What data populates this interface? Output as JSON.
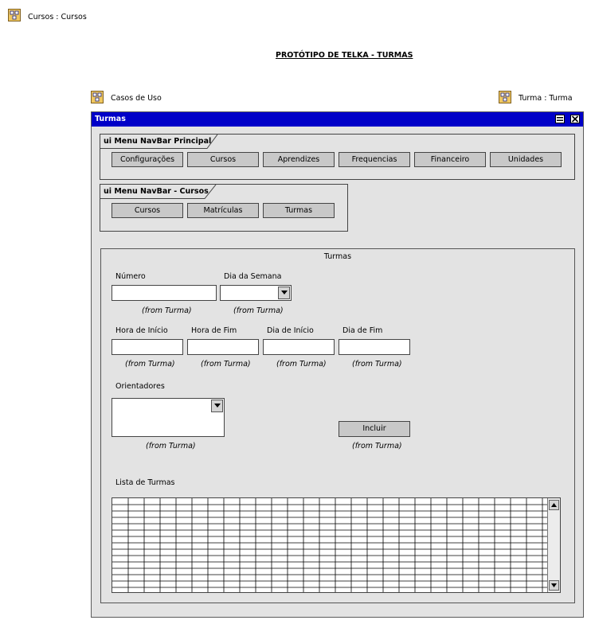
{
  "header": {
    "top_package_label": "Cursos : Cursos",
    "diagram_title": "PROTÓTIPO DE TELKA - TURMAS",
    "left_package_label": "Casos de Uso",
    "right_package_label": "Turma : Turma"
  },
  "window": {
    "title": "Turmas"
  },
  "navbar_principal": {
    "title": "ui Menu NavBar Principal",
    "items": [
      "Configurações",
      "Cursos",
      "Aprendizes",
      "Frequencias",
      "Financeiro",
      "Unidades"
    ]
  },
  "navbar_cursos": {
    "title": "ui Menu NavBar - Cursos",
    "items": [
      "Cursos",
      "Matrículas",
      "Turmas"
    ]
  },
  "form": {
    "title": "Turmas",
    "numero_label": "Número",
    "dia_semana_label": "Dia da Semana",
    "hora_inicio_label": "Hora de Início",
    "hora_fim_label": "Hora de Fim",
    "dia_inicio_label": "Dia de Início",
    "dia_fim_label": "Dia de Fim",
    "orientadores_label": "Orientadores",
    "incluir_label": "Incluir",
    "lista_label": "Lista de Turmas",
    "from_note": "(from Turma)"
  },
  "colors": {
    "titlebar": "#0000c8",
    "window_bg": "#e3e3e3",
    "button_bg": "#c8c8c8"
  },
  "icons": {
    "package": "package-icon",
    "minimize": "minimize-icon",
    "close": "close-icon",
    "dropdown": "chevron-down-icon",
    "scroll_up": "scroll-up-arrow-icon",
    "scroll_down": "scroll-down-arrow-icon"
  }
}
